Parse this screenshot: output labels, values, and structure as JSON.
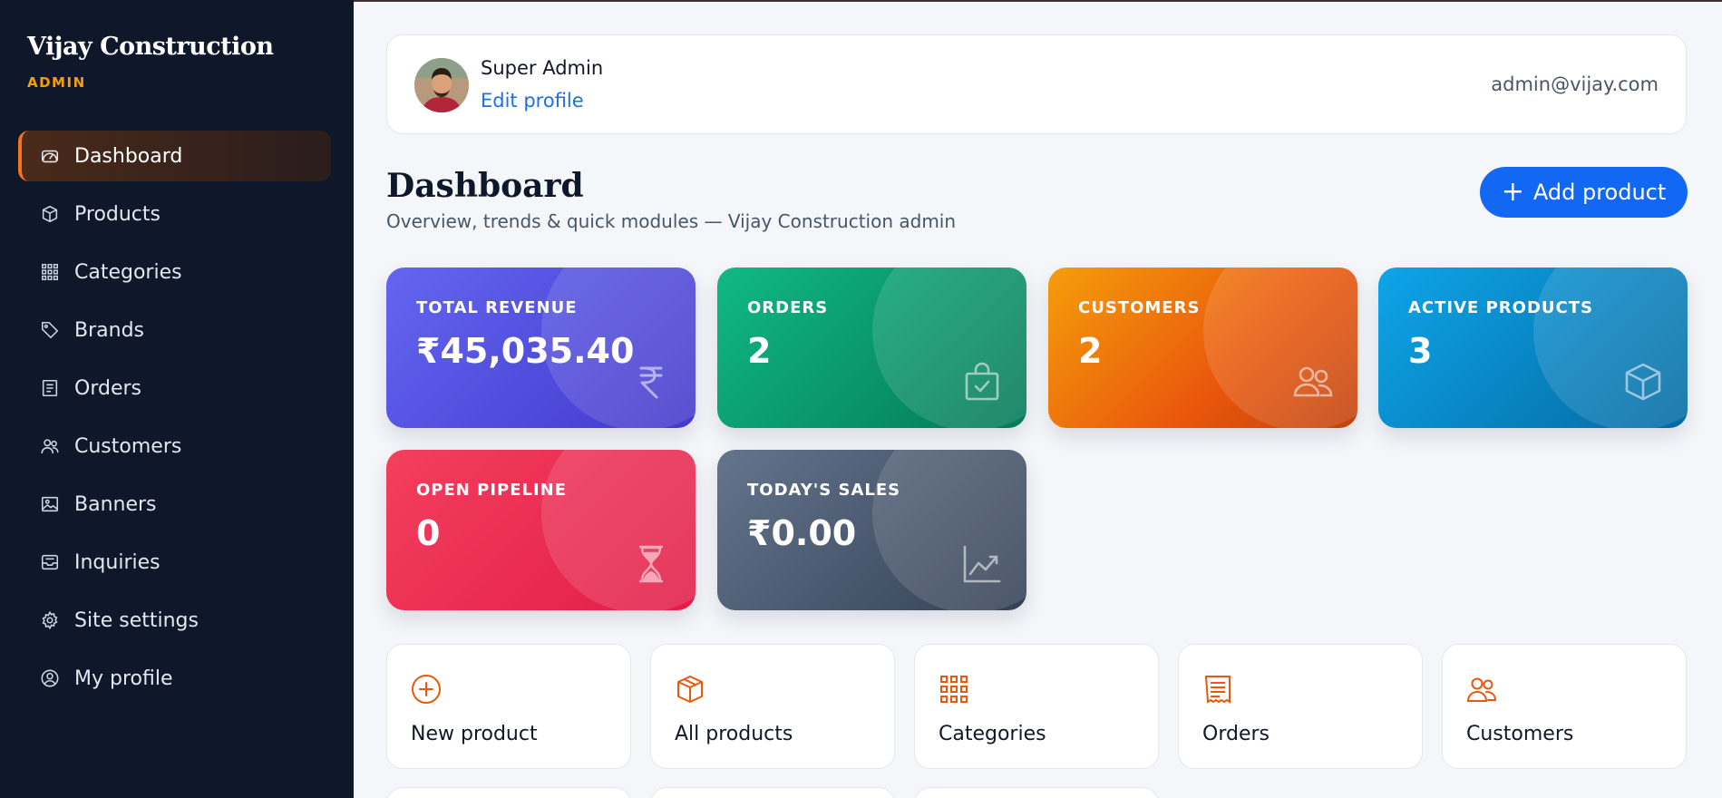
{
  "sidebar": {
    "brand": "Vijay Construction",
    "role": "ADMIN",
    "items": [
      {
        "label": "Dashboard",
        "icon": "gauge-icon"
      },
      {
        "label": "Products",
        "icon": "box-icon"
      },
      {
        "label": "Categories",
        "icon": "grid-icon"
      },
      {
        "label": "Brands",
        "icon": "tag-icon"
      },
      {
        "label": "Orders",
        "icon": "receipt-icon"
      },
      {
        "label": "Customers",
        "icon": "users-icon"
      },
      {
        "label": "Banners",
        "icon": "image-icon"
      },
      {
        "label": "Inquiries",
        "icon": "inbox-icon"
      },
      {
        "label": "Site settings",
        "icon": "gear-icon"
      },
      {
        "label": "My profile",
        "icon": "user-circle-icon"
      }
    ],
    "active_index": 0
  },
  "profile": {
    "name": "Super Admin",
    "edit_label": "Edit profile",
    "email": "admin@vijay.com"
  },
  "header": {
    "title": "Dashboard",
    "subtitle": "Overview, trends & quick modules — Vijay Construction admin",
    "add_button": "Add product"
  },
  "stats": [
    {
      "label": "TOTAL REVENUE",
      "value": "₹45,035.40",
      "icon": "rupee-icon",
      "color_from": "#6366f1",
      "color_to": "#4338ca"
    },
    {
      "label": "ORDERS",
      "value": "2",
      "icon": "shopping-bag-icon",
      "color_from": "#10b981",
      "color_to": "#047857"
    },
    {
      "label": "CUSTOMERS",
      "value": "2",
      "icon": "users-icon",
      "color_from": "#f59e0b",
      "color_to": "#ea580c"
    },
    {
      "label": "ACTIVE PRODUCTS",
      "value": "3",
      "icon": "box-icon",
      "color_from": "#0ea5e9",
      "color_to": "#0369a1"
    },
    {
      "label": "OPEN PIPELINE",
      "value": "0",
      "icon": "hourglass-icon",
      "color_from": "#f43f5e",
      "color_to": "#e11d48"
    },
    {
      "label": "TODAY'S SALES",
      "value": "₹0.00",
      "icon": "trend-chart-icon",
      "color_from": "#64748b",
      "color_to": "#334155"
    }
  ],
  "modules": [
    {
      "label": "New product",
      "icon": "plus-circle-icon"
    },
    {
      "label": "All products",
      "icon": "box-icon"
    },
    {
      "label": "Categories",
      "icon": "grid-icon"
    },
    {
      "label": "Orders",
      "icon": "receipt-icon"
    },
    {
      "label": "Customers",
      "icon": "users-icon"
    }
  ],
  "colors": {
    "sidebar_bg": "#0f172a",
    "accent_orange": "#f97316",
    "brand_gold": "#f59e0b",
    "primary_blue": "#1268f2"
  }
}
